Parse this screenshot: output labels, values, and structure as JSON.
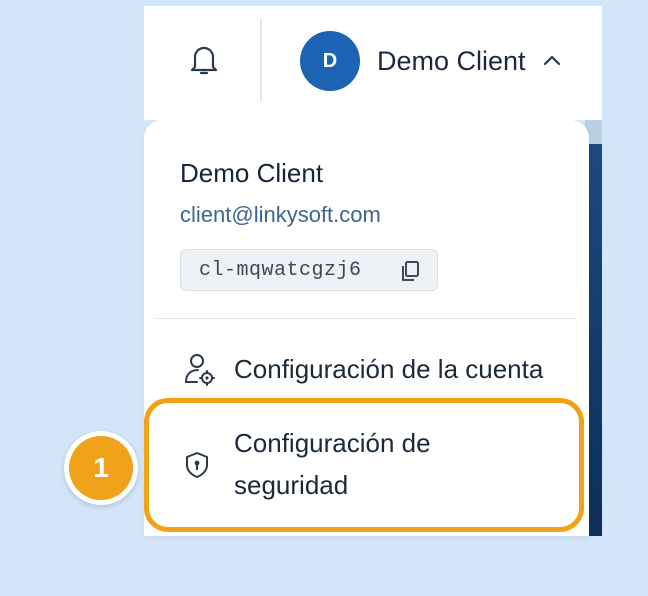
{
  "header": {
    "notifications_icon": "bell-icon",
    "avatar_initial": "D",
    "user_name": "Demo Client",
    "chevron_icon": "chevron-up-icon"
  },
  "dropdown": {
    "name": "Demo Client",
    "email": "client@linkysoft.com",
    "client_id": "cl-mqwatcgzj6",
    "copy_icon": "copy-icon",
    "menu": {
      "account_settings": {
        "label": "Configuración de la cuenta",
        "icon": "user-gear-icon"
      },
      "security_settings": {
        "label": "Configuración de seguridad",
        "icon": "shield-lock-icon"
      }
    }
  },
  "tutorial": {
    "step_number": "1"
  },
  "colors": {
    "background": "#d3e5f8",
    "accent": "#1d63b3",
    "highlight": "#f0a21b"
  }
}
